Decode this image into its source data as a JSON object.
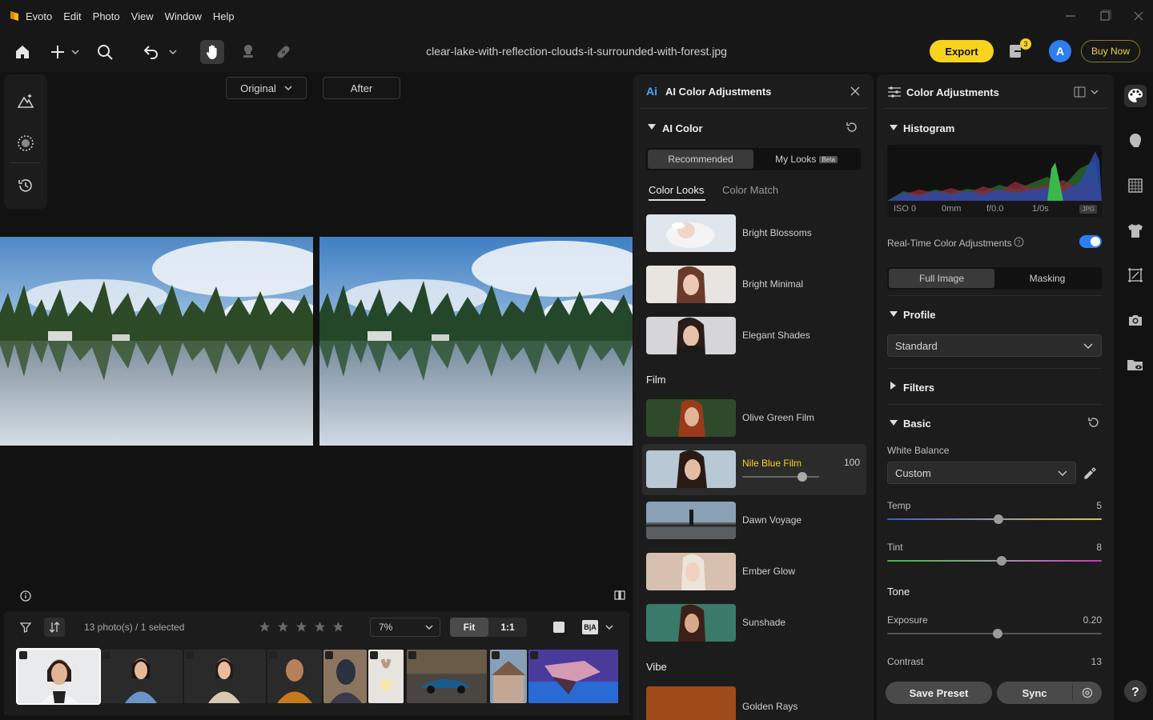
{
  "app": {
    "name": "Evoto"
  },
  "menu": [
    "Edit",
    "Photo",
    "View",
    "Window",
    "Help"
  ],
  "file": {
    "name": "clear-lake-with-reflection-clouds-it-surrounded-with-forest.jpg"
  },
  "toolbar": {
    "export_label": "Export",
    "buynow_label": "Buy Now",
    "avatar_letter": "A",
    "notif_count": "3"
  },
  "compare": {
    "original_label": "Original",
    "after_label": "After"
  },
  "bottom": {
    "photo_count": "13 photo(s) / 1 selected",
    "zoom": "7%",
    "fit_label": "Fit",
    "one_label": "1:1",
    "ba_label": "B|A"
  },
  "ai_panel": {
    "title": "AI Color Adjustments",
    "section": "AI Color",
    "seg": {
      "recommended": "Recommended",
      "mylooks": "My Looks",
      "beta": "Beta"
    },
    "tabs": {
      "color_looks": "Color Looks",
      "color_match": "Color Match"
    },
    "looks": [
      {
        "name": "Bright Blossoms"
      },
      {
        "name": "Bright Minimal"
      },
      {
        "name": "Elegant Shades"
      }
    ],
    "film_heading": "Film",
    "film": [
      {
        "name": "Olive Green Film"
      },
      {
        "name": "Nile Blue Film",
        "value": "100",
        "strength": 0.78
      },
      {
        "name": "Dawn Voyage"
      },
      {
        "name": "Ember Glow"
      },
      {
        "name": "Sunshade"
      }
    ],
    "vibe_heading": "Vibe",
    "vibe_partial": "Golden Rays"
  },
  "color_panel": {
    "title": "Color Adjustments",
    "histogram_label": "Histogram",
    "hist_meta": {
      "iso": "ISO 0",
      "focal": "0mm",
      "aperture": "f/0.0",
      "shutter": "1/0s",
      "format": "JPG"
    },
    "realtime_label": "Real-Time Color Adjustments",
    "scope": {
      "full": "Full Image",
      "masking": "Masking"
    },
    "profile_label": "Profile",
    "profile_value": "Standard",
    "filters_label": "Filters",
    "basic_label": "Basic",
    "wb_label": "White Balance",
    "wb_value": "Custom",
    "temp": {
      "label": "Temp",
      "value": "5",
      "pos": 0.52
    },
    "tint": {
      "label": "Tint",
      "value": "8",
      "pos": 0.535
    },
    "tone_label": "Tone",
    "exposure": {
      "label": "Exposure",
      "value": "0.20",
      "pos": 0.515
    },
    "contrast": {
      "label": "Contrast",
      "value": "13"
    },
    "save_preset": "Save Preset",
    "sync": "Sync"
  },
  "colors": {
    "accent": "#f7d21f",
    "toggle": "#2e7ef0",
    "panel": "#1c1c1c"
  }
}
